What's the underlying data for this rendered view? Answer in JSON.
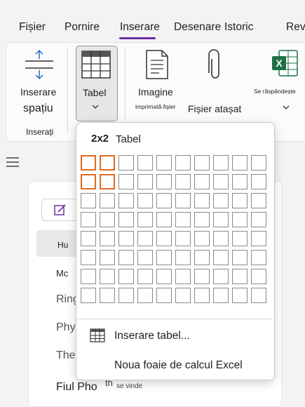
{
  "tabs": [
    "Fișier",
    "Pornire",
    "Inserare",
    "Desenare",
    "Istoric",
    "Rev"
  ],
  "ribbon": {
    "insert_space_label_1": "Inserare",
    "insert_space_label_2": "spațiu",
    "group_label": "Inserați",
    "table_label": "Tabel",
    "image_label": "Imagine",
    "printout_label": "imprimată fișier",
    "attach_label": "Fișier atașat",
    "spreadsheet_label": "Se răspândește"
  },
  "background": {
    "row1": "Hu",
    "row2": "Mc",
    "row3": "Ring",
    "row4": "Phy",
    "row5": "The",
    "row6": "Fiul Pho",
    "row6_suffix": "th",
    "row6_small": "se vinde"
  },
  "table_menu": {
    "size": "2x2",
    "title": "Tabel",
    "grid": {
      "columns": 10,
      "rows": 8,
      "selected_columns": 2,
      "selected_rows": 2
    },
    "insert_table": "Inserare tabel...",
    "new_sheet": "Noua foaie de calcul Excel"
  },
  "colors": {
    "accent": "#6b2fa5",
    "selection": "#e06a1e",
    "excel_green": "#1e7145",
    "icon_blue": "#1e6fc0"
  }
}
